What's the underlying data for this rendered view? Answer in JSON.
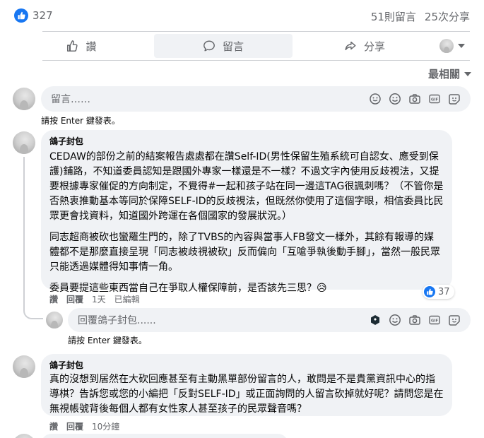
{
  "reactions": {
    "like_count": "327",
    "comments": "51則留言",
    "shares": "25次分享"
  },
  "actions": {
    "like": "讚",
    "comment": "留言",
    "share": "分享"
  },
  "sort": {
    "label": "最相關"
  },
  "composer": {
    "placeholder": "留言……",
    "hint": "請按 Enter 鍵發表。"
  },
  "comments": [
    {
      "author": "鴿子封包",
      "paragraphs": [
        "CEDAW的部份之前的結案報告處處都在讚Self-ID(男性保留生殖系統可自認女、應受到保護)鋪路，不知道委員認知是跟國外專家一樣還是不一樣？不過文字內使用反歧視法，又提要根據專家催促的方向制定，不覺得#一起和孩子站在同一邊這TAG很諷刺嗎？（不管你是否熱衷推動基本等同於保障SELF-ID的反歧視法，但既然你使用了這個字眼，相信委員比民眾更會找資料，知道國外跨運在各個國家的發展狀況。）",
        "同志超商被砍也蠻羅生門的，除了TVBS的內容與當事人FB發文一樣外，其餘有報導的媒體都不是那麼直接呈現「同志被歧視被砍」反而偏向「互嗆爭執後動手腳」，當然一般民眾只能透過媒體得知事情一角。",
        "委員要提這些東西當自己在爭取人權保障前，是否該先三思？"
      ],
      "emoji": "😥",
      "meta": {
        "like": "讚",
        "reply": "回覆",
        "time": "1天",
        "edited": "已編輯"
      },
      "reaction_count": "37"
    },
    {
      "author": "鴿子封包",
      "paragraphs": [
        "真的沒想到居然在大砍回應甚至有主動黑單部份留言的人，敢問是不是貴黨資訊中心的指導棋？告訴您或您的小編把「反對SELF-ID」或正面詢問的人留言砍掉就好呢？請問您是在無視帳號背後每個人都有女性家人甚至孩子的民眾聲音嗎？"
      ],
      "meta": {
        "like": "讚",
        "reply": "回覆",
        "time": "10分鐘"
      }
    }
  ],
  "reply_composer": {
    "placeholder": "回覆鴿子封包......",
    "hint": "請按 Enter 鍵發表。"
  },
  "colors": {
    "accent": "#1877f2",
    "bubble": "#f0f2f5",
    "muted": "#65676b"
  },
  "icons": [
    "like-icon",
    "comment-icon",
    "share-icon",
    "chevron-down-icon",
    "sticker-icon",
    "emoji-icon",
    "camera-icon",
    "gif-icon",
    "avatar-sticker-icon"
  ]
}
